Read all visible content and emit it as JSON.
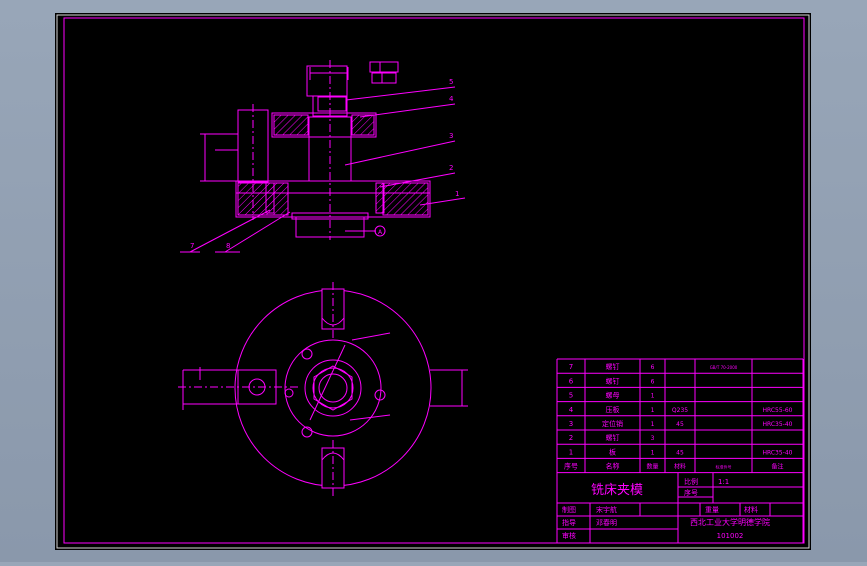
{
  "colors": {
    "background_outer": "#92a0b3",
    "canvas": "#000000",
    "frame": "#ffffff",
    "line": "#ff00ff",
    "dim": "#e040e0"
  },
  "leaders": [
    "5",
    "4",
    "3",
    "2",
    "1",
    "7",
    "8"
  ],
  "datum_marker": "A",
  "title_block": {
    "bom_rows": [
      {
        "no": "7",
        "name": "螺钉",
        "qty": "6",
        "material": "",
        "std": "GB/T 70-2000",
        "note": ""
      },
      {
        "no": "6",
        "name": "螺钉",
        "qty": "6",
        "material": "",
        "std": "",
        "note": ""
      },
      {
        "no": "5",
        "name": "螺母",
        "qty": "1",
        "material": "",
        "std": "",
        "note": ""
      },
      {
        "no": "4",
        "name": "压板",
        "qty": "1",
        "material": "Q235",
        "std": "",
        "note": "HRC55-60"
      },
      {
        "no": "3",
        "name": "定位销",
        "qty": "1",
        "material": "45",
        "std": "",
        "note": "HRC35-40"
      },
      {
        "no": "2",
        "name": "螺钉",
        "qty": "3",
        "material": "",
        "std": "",
        "note": ""
      },
      {
        "no": "1",
        "name": "板",
        "qty": "1",
        "material": "45",
        "std": "",
        "note": "HRC35-40"
      }
    ],
    "header": {
      "no": "序号",
      "name": "名称",
      "qty": "数量",
      "material": "材料",
      "std": "标准件号",
      "note": "备注"
    },
    "drawing_title": "铣床夹模",
    "scale_label": "比例",
    "scale_value": "1:1",
    "seq_label": "序号",
    "weight_label": "重量",
    "material_label": "材料",
    "designer_label": "制图",
    "designer_name": "宋宇航",
    "checker_label": "指导",
    "checker_name": "邓春明",
    "reviewer_label": "审核",
    "school": "西北工业大学明德学院",
    "drawing_number": "101002"
  }
}
